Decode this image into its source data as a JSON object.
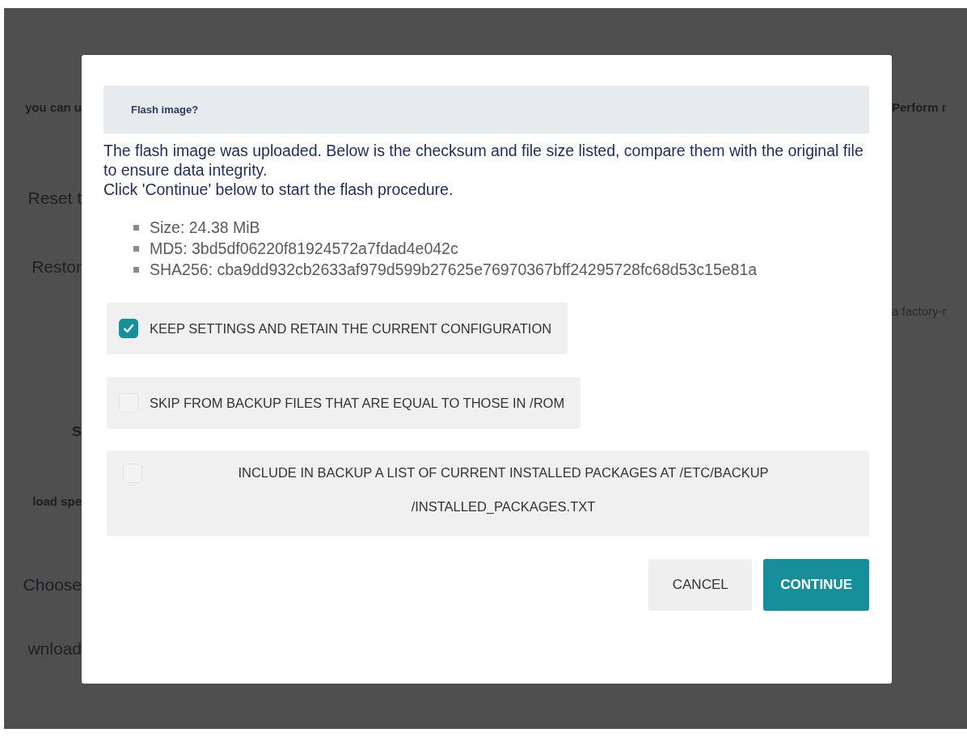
{
  "background": {
    "left": [
      {
        "text": "you can u",
        "kind": "strong"
      },
      {
        "text": "Reset t",
        "kind": "plain"
      },
      {
        "text": "Restor",
        "kind": "plain"
      },
      {
        "text": "s",
        "kind": "heading"
      },
      {
        "text": "load spe",
        "kind": "strong"
      },
      {
        "text": "Choose",
        "kind": "plain"
      },
      {
        "text": "wnload",
        "kind": "plain"
      }
    ],
    "right": [
      {
        "text": "Perform r",
        "kind": "strong"
      },
      {
        "text": "a factory-r",
        "kind": "small"
      }
    ]
  },
  "dialog": {
    "title": "Flash image?",
    "message": [
      "The flash image was uploaded. Below is the checksum and file size listed, compare them with the original file to ensure data integrity.",
      "Click 'Continue' below to start the flash procedure."
    ],
    "details": [
      "Size: 24.38 MiB",
      "MD5: 3bd5df06220f81924572a7fdad4e042c",
      "SHA256: cba9dd932cb2633af979d599b27625e76970367bff24295728fc68d53c15e81a"
    ],
    "options": [
      {
        "label": "KEEP SETTINGS AND RETAIN THE CURRENT CONFIGURATION",
        "checked": true
      },
      {
        "label": "SKIP FROM BACKUP FILES THAT ARE EQUAL TO THOSE IN /ROM",
        "checked": false
      },
      {
        "label": "INCLUDE IN BACKUP A LIST OF CURRENT INSTALLED PACKAGES AT /ETC/BACKUP /INSTALLED_PACKAGES.TXT",
        "checked": false
      }
    ],
    "buttons": [
      {
        "label": "CANCEL",
        "kind": "secondary"
      },
      {
        "label": "CONTINUE",
        "kind": "primary"
      }
    ]
  }
}
